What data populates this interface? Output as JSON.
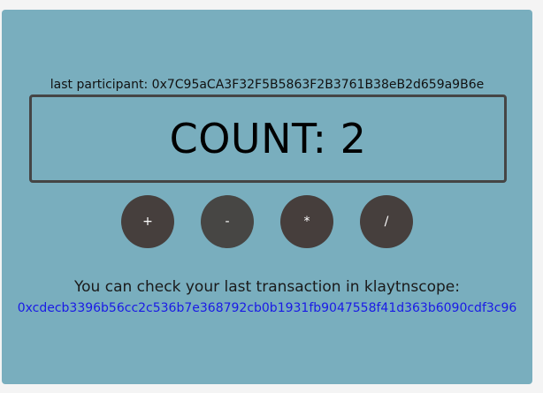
{
  "participant": {
    "text": "last participant: 0x7C95aCA3F32F5B5863F2B3761B38eB2d659a9B6e"
  },
  "counter": {
    "text": "COUNT: 2"
  },
  "buttons": {
    "plus": "+",
    "minus": "-",
    "multiply": "*",
    "divide": "/"
  },
  "transaction": {
    "label": "You can check your last transaction in klaytnscope:",
    "hash": "0xcdecb3396b56cc2c536b7e368792cb0b1931fb9047558f41d363b6090cdf3c96"
  },
  "colors": {
    "panel_background": "#79aebe",
    "button_background": "#463f3d",
    "link": "#1a1ae6",
    "count_border": "#454545"
  }
}
